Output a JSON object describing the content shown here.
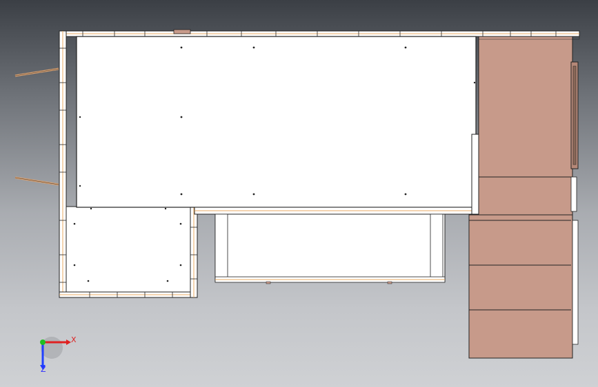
{
  "viewport": {
    "background_top": "#3b3f45",
    "background_bottom": "#cfd1d4"
  },
  "model": {
    "panel_color": "#ffffff",
    "edge_color": "#e8a860",
    "cabinet_color": "#c79a8a",
    "line_color": "#222222"
  },
  "triad": {
    "x_label": "X",
    "z_label": "Z",
    "x_color": "#e02020",
    "y_color": "#20c020",
    "z_color": "#2040ff"
  }
}
